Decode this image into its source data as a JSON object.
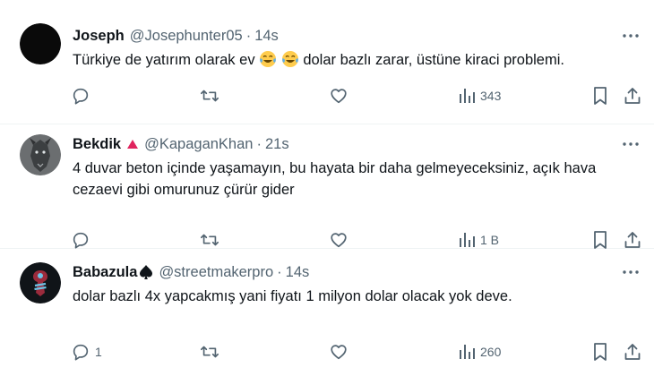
{
  "tweets": [
    {
      "author_name": "Joseph",
      "handle": "@Josephunter05",
      "time": "14s",
      "text_before": "Türkiye de yatırım olarak ev ",
      "text_after": " dolar bazlı zarar, üstüne kiraci problemi.",
      "emojis": [
        "tears-of-joy-emoji",
        "tears-of-joy-emoji"
      ],
      "reply_count": "",
      "views": "343"
    },
    {
      "author_name": "Bekdik",
      "badge": "red-triangle-icon",
      "handle": "@KapaganKhan",
      "time": "21s",
      "text": "4 duvar beton içinde yaşamayın, bu hayata bir daha gelmeyeceksiniz, açık hava cezaevi gibi omurunuz çürür gider",
      "reply_count": "",
      "views": "1 B"
    },
    {
      "author_name": "Babazula",
      "badge": "spade-icon",
      "handle": "@streetmakerpro",
      "time": "14s",
      "text": "dolar bazlı 4x yapcakmış yani fiyatı 1 milyon dolar olacak yok deve.",
      "reply_count": "1",
      "views": "260"
    }
  ],
  "separator": "·",
  "colors": {
    "text": "#0f1419",
    "secondary": "#536471",
    "divider": "#eff3f4",
    "badge_red": "#e0245e"
  }
}
